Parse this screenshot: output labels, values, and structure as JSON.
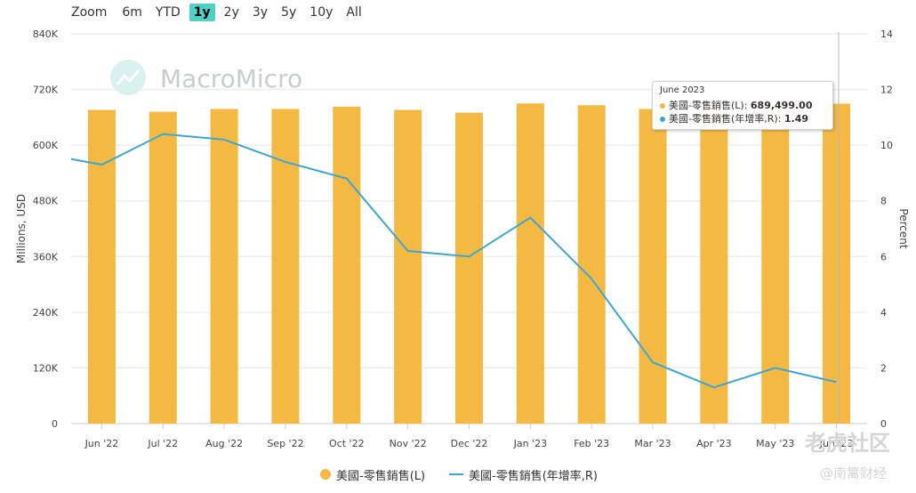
{
  "zoom": {
    "label": "Zoom",
    "options": [
      "6m",
      "YTD",
      "1y",
      "2y",
      "3y",
      "5y",
      "10y",
      "All"
    ],
    "active": "1y"
  },
  "logo": {
    "text": "MacroMicro"
  },
  "tooltip": {
    "date": "June 2023",
    "rows": [
      {
        "name": "美國-零售銷售(L)",
        "value": "689,499.00",
        "color": "#f4b942"
      },
      {
        "name": "美國-零售銷售(年增率,R)",
        "value": "1.49",
        "color": "#3aa8d1"
      }
    ]
  },
  "watermark": {
    "line1": "老虎社区",
    "line2": "@南篱财经"
  },
  "colors": {
    "bar": "#f4b942",
    "line": "#3aa8d1",
    "zoom_active": "#4fd1c5"
  },
  "chart_data": {
    "type": "bar",
    "categories": [
      "Jun '22",
      "Jul '22",
      "Aug '22",
      "Sep '22",
      "Oct '22",
      "Nov '22",
      "Dec '22",
      "Jan '23",
      "Feb '23",
      "Mar '23",
      "Apr '23",
      "May '23",
      "Jun '23"
    ],
    "series": [
      {
        "name": "美國-零售銷售(L)",
        "type": "bar",
        "axis": "left",
        "values": [
          676000,
          672000,
          678000,
          678000,
          683000,
          676000,
          670000,
          690000,
          686000,
          678000,
          684000,
          686000,
          689499
        ]
      },
      {
        "name": "美國-零售銷售(年增率,R)",
        "type": "line",
        "axis": "right",
        "values": [
          9.3,
          10.4,
          10.2,
          9.4,
          8.8,
          6.2,
          6.0,
          7.4,
          5.2,
          2.2,
          1.3,
          2.0,
          1.49
        ]
      }
    ],
    "y_left": {
      "label": "Millions, USD",
      "min": 0,
      "max": 840000,
      "ticks": [
        "0",
        "120K",
        "240K",
        "360K",
        "480K",
        "600K",
        "720K",
        "840K"
      ]
    },
    "y_right": {
      "label": "Percent",
      "min": 0,
      "max": 14,
      "ticks": [
        "0",
        "2",
        "4",
        "6",
        "8",
        "10",
        "12",
        "14"
      ]
    },
    "line_start_value": 9.5,
    "grid": true,
    "legend": "bottom-center"
  }
}
